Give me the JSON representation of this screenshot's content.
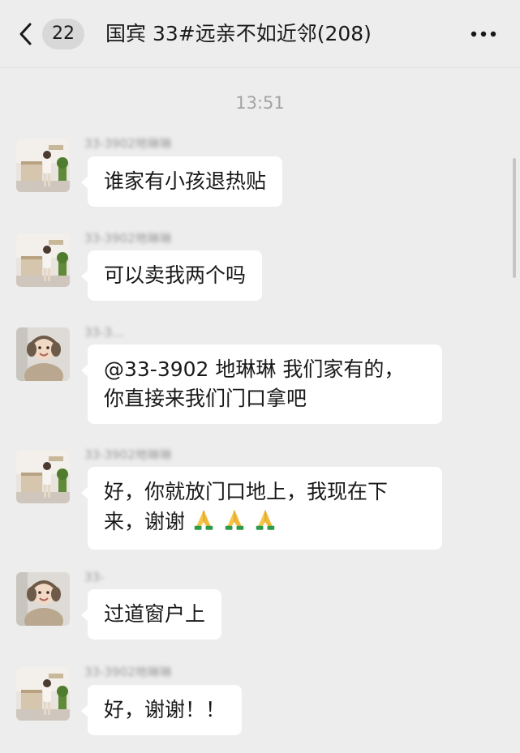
{
  "header": {
    "unread_count": "22",
    "title": "国宾 33#远亲不如近邻(208)"
  },
  "time": "13:51",
  "messages": [
    {
      "nick": "33-3902地琳琳",
      "avatar": "avatar-office-photo",
      "lines": [
        "谁家有小孩退热贴"
      ]
    },
    {
      "nick": "33-3902地琳琳",
      "avatar": "avatar-office-photo",
      "lines": [
        "可以卖我两个吗"
      ]
    },
    {
      "nick": "33-3...",
      "avatar": "avatar-child-photo",
      "lines": [
        "@33-3902 地琳琳 我们家有的，",
        "你直接来我们门口拿吧"
      ]
    },
    {
      "nick": "33-3902地琳琳",
      "avatar": "avatar-office-photo",
      "lines": [
        "好，你就放门口地上，我现在下",
        "来，谢谢"
      ],
      "emoji": "folded-hands-icon x3"
    },
    {
      "nick": "33-",
      "avatar": "avatar-child-photo",
      "lines": [
        "过道窗户上"
      ]
    },
    {
      "nick": "33-3902地琳琳",
      "avatar": "avatar-office-photo",
      "lines": [
        "好，谢谢！！"
      ]
    }
  ],
  "icons": {
    "back": "chevron-left-icon",
    "more": "more-dots-icon",
    "praying": "folded-hands-icon"
  },
  "colors": {
    "background": "#ededed",
    "bubble": "#ffffff",
    "time_text": "#a3a3a3"
  }
}
